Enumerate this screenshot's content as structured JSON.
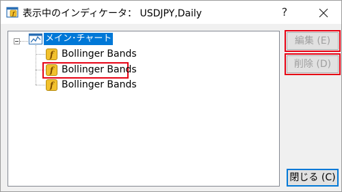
{
  "window": {
    "title": "表示中のインディケータ： USDJPY,Daily",
    "help_label": "?",
    "close_label": "close"
  },
  "tree": {
    "root": {
      "label": "メイン･チャート",
      "icon": "chart-window-icon"
    },
    "items": [
      {
        "label": "Bollinger Bands",
        "icon": "function-icon",
        "highlighted": false
      },
      {
        "label": "Bollinger Bands",
        "icon": "function-icon",
        "highlighted": true
      },
      {
        "label": "Bollinger Bands",
        "icon": "function-icon",
        "highlighted": false
      }
    ]
  },
  "buttons": {
    "edit_label": "編集 (E)",
    "delete_label": "削除 (D)",
    "close_label": "閉じる (C)"
  },
  "colors": {
    "selection": "#0078d7",
    "highlight_border": "#e60012",
    "icon_gold": "#f2c12e"
  }
}
